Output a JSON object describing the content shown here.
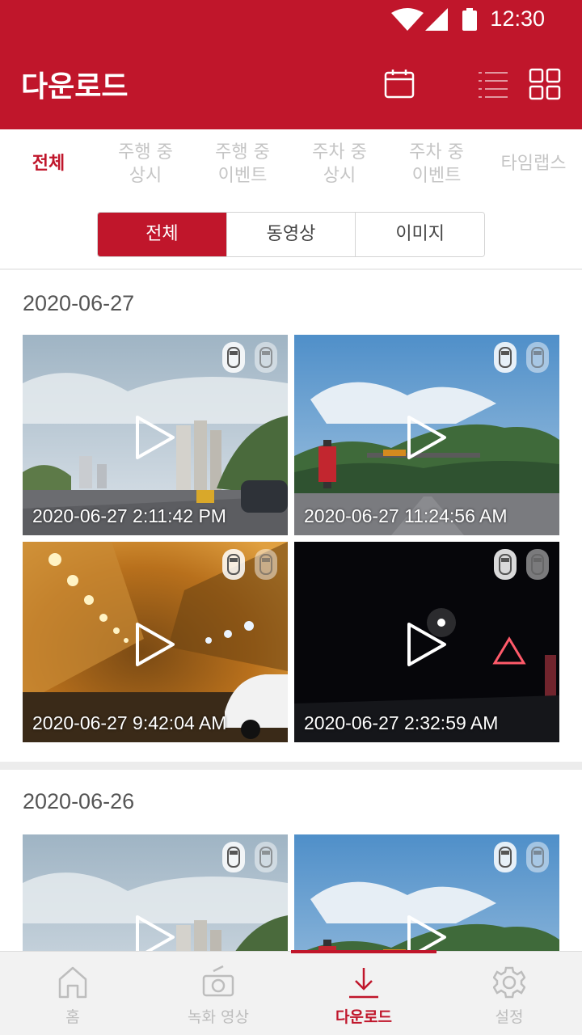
{
  "status": {
    "time": "12:30"
  },
  "appbar": {
    "title": "다운로드",
    "icons": [
      "calendar-icon",
      "list-view-icon",
      "grid-view-icon"
    ]
  },
  "tabs": [
    {
      "line1": "전체",
      "line2": ""
    },
    {
      "line1": "주행 중",
      "line2": "상시"
    },
    {
      "line1": "주행 중",
      "line2": "이벤트"
    },
    {
      "line1": "주차 중",
      "line2": "상시"
    },
    {
      "line1": "주차 중",
      "line2": "이벤트"
    },
    {
      "line1": "타임랩스",
      "line2": ""
    }
  ],
  "segments": [
    "전체",
    "동영상",
    "이미지"
  ],
  "sections": [
    {
      "date": "2020-06-27",
      "items": [
        {
          "timestamp": "2020-06-27 2:11:42 PM",
          "scene": "day-city"
        },
        {
          "timestamp": "2020-06-27 11:24:56 AM",
          "scene": "day-mountain"
        },
        {
          "timestamp": "2020-06-27 9:42:04 AM",
          "scene": "tunnel"
        },
        {
          "timestamp": "2020-06-27 2:32:59 AM",
          "scene": "night"
        }
      ]
    },
    {
      "date": "2020-06-26",
      "items": [
        {
          "timestamp": "",
          "scene": "day-city"
        },
        {
          "timestamp": "",
          "scene": "day-mountain"
        }
      ]
    }
  ],
  "bottom_nav": [
    {
      "label": "홈",
      "icon": "home-icon"
    },
    {
      "label": "녹화 영상",
      "icon": "camera-icon"
    },
    {
      "label": "다운로드",
      "icon": "download-icon"
    },
    {
      "label": "설정",
      "icon": "gear-icon"
    }
  ],
  "colors": {
    "brand": "#c0162b",
    "inactive": "#c5c5c5"
  }
}
